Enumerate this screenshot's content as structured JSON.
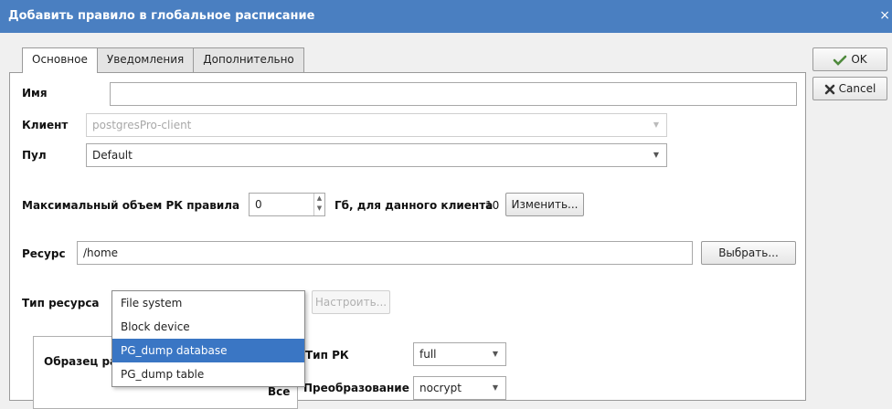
{
  "window": {
    "title": "Добавить правило в глобальное расписание",
    "close_glyph": "×"
  },
  "tabs": [
    {
      "label": "Основное",
      "active": true
    },
    {
      "label": "Уведомления",
      "active": false
    },
    {
      "label": "Дополнительно",
      "active": false
    }
  ],
  "form": {
    "name_label": "Имя",
    "name_value": "",
    "client_label": "Клиент",
    "client_value": "postgresPro-client",
    "pool_label": "Пул",
    "pool_value": "Default",
    "max_volume_label": "Максимальный объем РК правила",
    "max_volume_value": "0",
    "gb_label": "Гб, для данного клиента",
    "client_gb_value": "10",
    "change_button": "Изменить...",
    "resource_label": "Ресурс",
    "resource_value": "/home",
    "choose_button": "Выбрать...",
    "resource_type_label": "Тип ресурса",
    "configure_button": "Настроить...",
    "sample_label": "Образец ра",
    "all_label": "Все",
    "backup_type_label": "Тип РК",
    "backup_type_value": "full",
    "transform_label": "Преобразование",
    "transform_value": "nocrypt"
  },
  "resource_type_options": [
    {
      "label": "File system",
      "selected": false
    },
    {
      "label": "Block device",
      "selected": false
    },
    {
      "label": "PG_dump database",
      "selected": true
    },
    {
      "label": "PG_dump table",
      "selected": false
    }
  ],
  "actions": {
    "ok_label": "OK",
    "cancel_label": "Cancel"
  },
  "colors": {
    "titlebar": "#4a7fc1",
    "selection": "#3a76c4",
    "cancel_icon": "#333333",
    "ok_icon": "#4f8a3c"
  }
}
